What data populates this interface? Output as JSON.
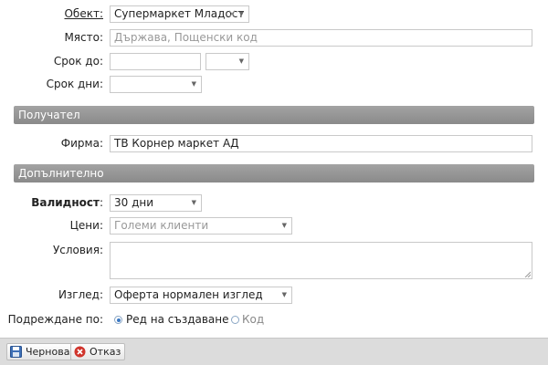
{
  "form": {
    "object": {
      "label": "Обект:",
      "value": "Супермаркет Младост",
      "clear": "×",
      "caret": "▼"
    },
    "place": {
      "label": "Място:",
      "placeholder": "Държава, Пощенски код"
    },
    "due_date": {
      "label": "Срок до:",
      "caret": "▼"
    },
    "due_days": {
      "label": "Срок дни:",
      "caret": "▼"
    }
  },
  "recipient": {
    "header": "Получател",
    "company": {
      "label": "Фирма:",
      "value": "ТВ Корнер маркет АД"
    }
  },
  "additional": {
    "header": "Допълнително",
    "validity": {
      "label": "Валидност",
      "colon": ":",
      "value": "30 дни",
      "caret": "▼"
    },
    "prices": {
      "label": "Цени:",
      "value": "Големи клиенти",
      "caret": "▼"
    },
    "conditions": {
      "label": "Условия:",
      "value": ""
    },
    "view": {
      "label": "Изглед:",
      "value": "Оферта нормален изглед",
      "caret": "▼"
    },
    "ordering": {
      "label": "Подреждане по:",
      "options": [
        "Ред на създаване",
        "Код"
      ],
      "selected": 0
    }
  },
  "toolbar": {
    "draft_label": "Чернова",
    "cancel_label": "Отказ"
  },
  "colors": {
    "section_bg": "#959595",
    "footer_bg": "#dcdcdc",
    "radio_accent": "#3a78c3"
  }
}
